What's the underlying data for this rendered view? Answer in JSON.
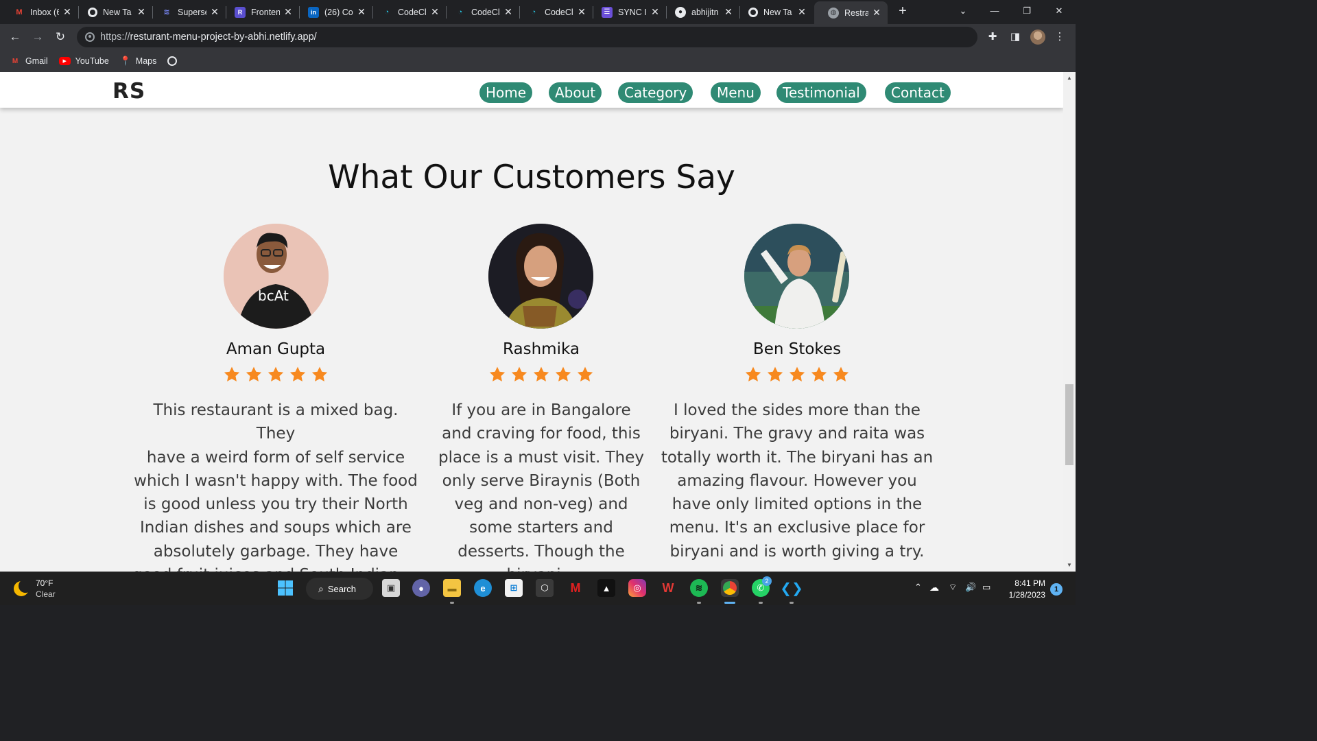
{
  "browser": {
    "tabs": [
      {
        "title": "Inbox (6",
        "icon": "gmail-icon"
      },
      {
        "title": "New Ta",
        "icon": "chrome-icon"
      },
      {
        "title": "Superse",
        "icon": "superset-icon"
      },
      {
        "title": "Fronten",
        "icon": "r-app-icon"
      },
      {
        "title": "(26) Co",
        "icon": "linkedin-icon"
      },
      {
        "title": "CodeCl",
        "icon": "codeclause-icon"
      },
      {
        "title": "CodeCl",
        "icon": "codeclause-icon"
      },
      {
        "title": "CodeCl",
        "icon": "codeclause-icon"
      },
      {
        "title": "SYNC Ir",
        "icon": "sync-icon"
      },
      {
        "title": "abhijitn",
        "icon": "github-icon"
      },
      {
        "title": "New Ta",
        "icon": "chrome-icon"
      },
      {
        "title": "Restrau",
        "icon": "globe-icon",
        "active": true
      }
    ],
    "url_scheme": "https://",
    "url_host": "resturant-menu-project-by-abhi.netlify.app/",
    "bookmarks": [
      {
        "label": "Gmail",
        "icon": "gmail-icon"
      },
      {
        "label": "YouTube",
        "icon": "youtube-icon"
      },
      {
        "label": "Maps",
        "icon": "maps-icon"
      }
    ]
  },
  "site": {
    "logo": "RS",
    "nav": [
      "Home",
      "About",
      "Category",
      "Menu",
      "Testimonial",
      "Contact"
    ],
    "accent_color": "#2f8a74",
    "star_color": "#f7891f",
    "section_title": "What Our Customers Say",
    "testimonials": [
      {
        "name": "Aman Gupta",
        "rating": 5,
        "review_lines": [
          "This restaurant is a mixed bag. They",
          "have a weird form of self service",
          "which I wasn't happy with. The food",
          "is good unless you try their North",
          "Indian dishes and soups which are",
          "absolutely garbage. They have",
          "good fruit juices and South Indian ..."
        ]
      },
      {
        "name": "Rashmika",
        "rating": 5,
        "review_lines": [
          "If you are in Bangalore",
          "and craving for food, this",
          "place is a must visit. They",
          "only serve Biraynis (Both",
          "veg and non-veg) and",
          "some starters and",
          "desserts. Though the",
          "biryani..."
        ]
      },
      {
        "name": "Ben Stokes",
        "rating": 5,
        "review_lines": [
          "I loved the sides more than the",
          "biryani. The gravy and raita was",
          "totally worth it. The biryani has an",
          "amazing flavour. However you",
          "have only limited options in the",
          "menu. It's an exclusive place for",
          "biryani and is worth giving a try."
        ]
      }
    ]
  },
  "taskbar": {
    "temperature": "70°F",
    "condition": "Clear",
    "search_label": "Search",
    "whatsapp_badge": "2",
    "time": "8:41 PM",
    "date": "1/28/2023",
    "notification_count": "1"
  }
}
